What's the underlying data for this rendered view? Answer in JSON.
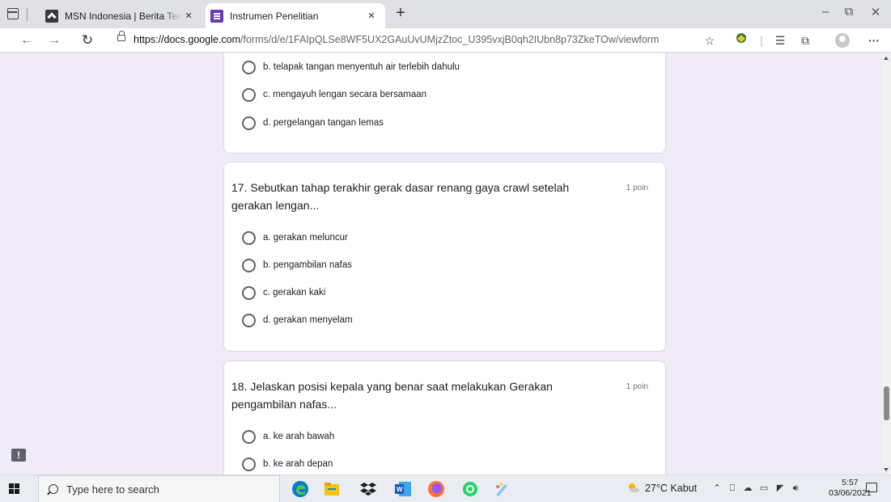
{
  "browser": {
    "tabs": [
      {
        "title": "MSN Indonesia | Berita Terkini Hari Ini",
        "active": false
      },
      {
        "title": "Instrumen Penelitian",
        "active": true
      }
    ],
    "url_host": "https://docs.google.com",
    "url_path": "/forms/d/e/1FAIpQLSe8WF5UX2GAuUvUMjzZtoc_U395vxjB0qh2IUbn8p73ZkeTOw/viewform",
    "tab_close": "×",
    "new_tab": "+",
    "more_menu": "···"
  },
  "form": {
    "prev_question_options": [
      "b. telapak tangan menyentuh air terlebih dahulu",
      "c. mengayuh lengan secara bersamaan",
      "d. pergelangan tangan lemas"
    ],
    "questions": [
      {
        "text": "17. Sebutkan tahap terakhir gerak dasar renang gaya crawl setelah gerakan lengan...",
        "points": "1 poin",
        "options": [
          "a. gerakan meluncur",
          "b. pengambilan nafas",
          "c. gerakan kaki",
          "d. gerakan menyelam"
        ]
      },
      {
        "text": "18. Jelaskan posisi kepala yang benar saat melakukan Gerakan pengambilan nafas...",
        "points": "1 poin",
        "options": [
          "a. ke arah bawah",
          "b. ke arah depan"
        ]
      }
    ]
  },
  "taskbar": {
    "search_placeholder": "Type here to search",
    "weather": "27°C  Kabut",
    "time": "5:57",
    "date": "03/06/2021"
  },
  "colors": {
    "page_bg": "#f0ebf8",
    "forms_purple": "#673ab7",
    "edge_blue": "#0078d7"
  }
}
